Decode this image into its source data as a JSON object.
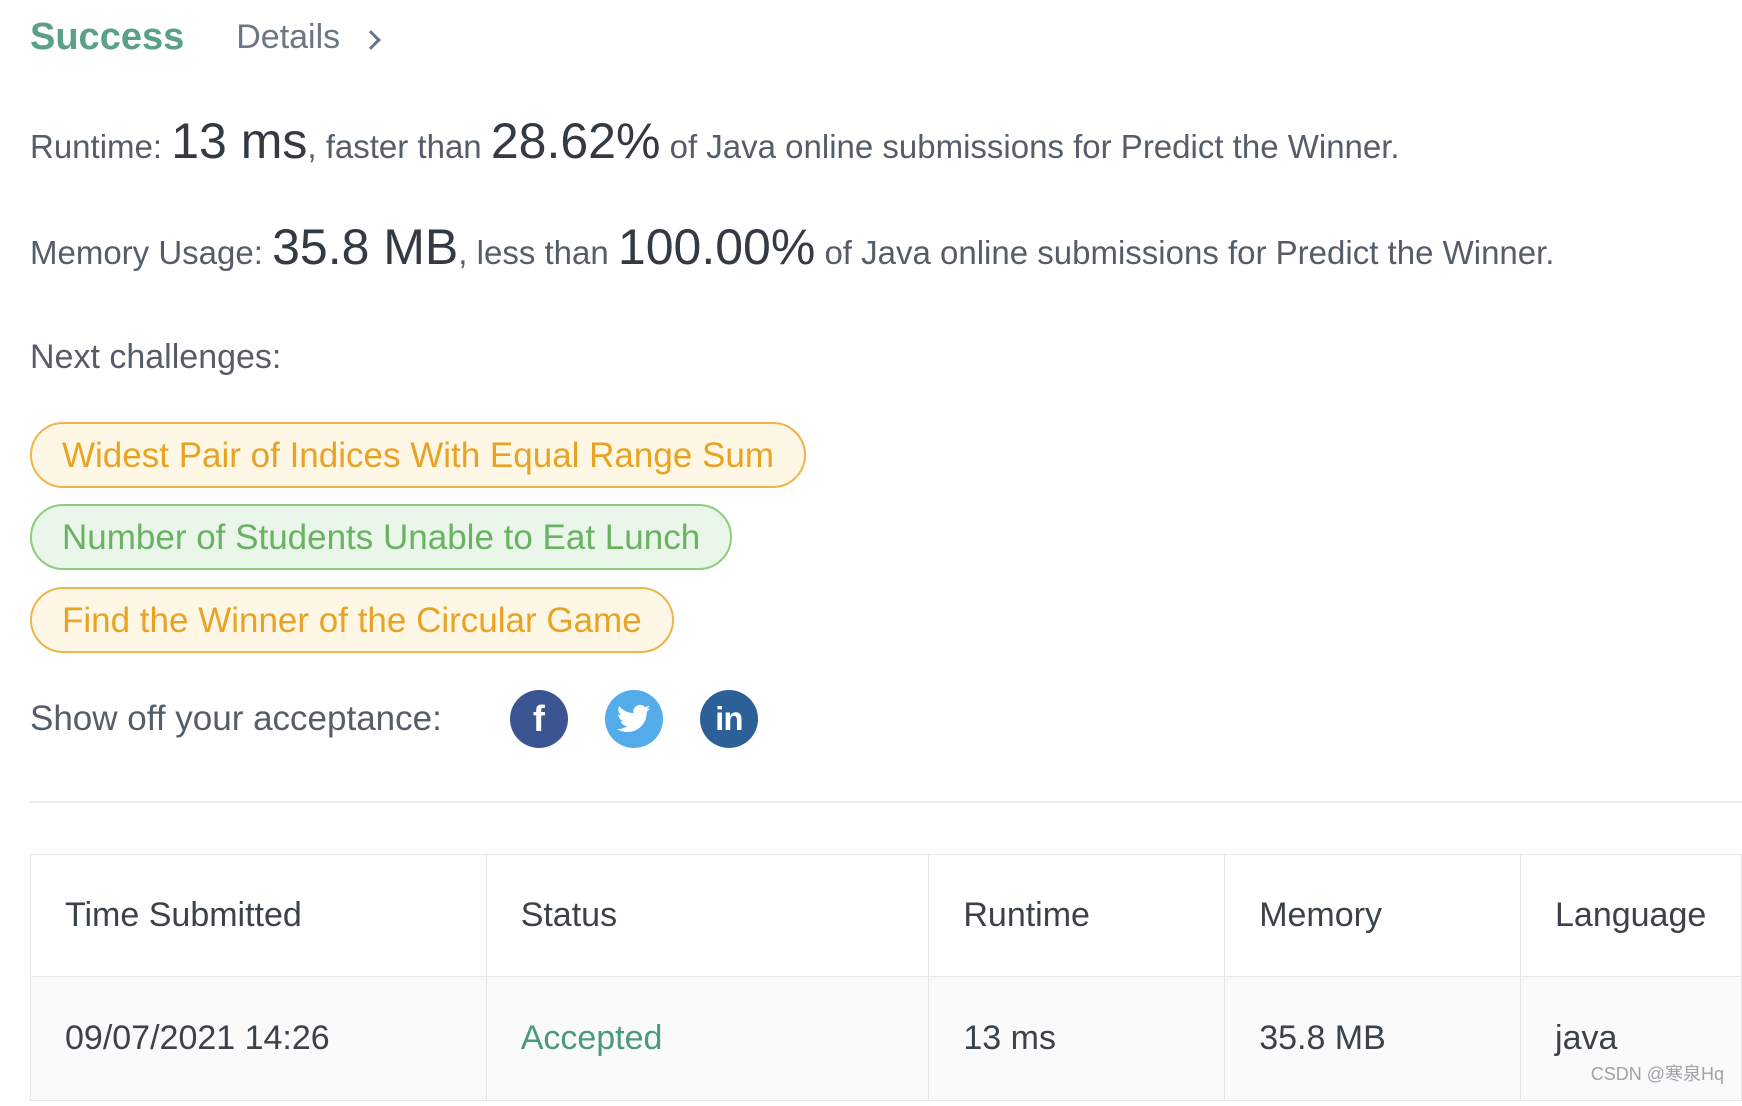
{
  "tabs": {
    "success": "Success",
    "details": "Details"
  },
  "runtime": {
    "label": "Runtime: ",
    "value": "13 ms",
    "mid": ", faster than ",
    "percent": "28.62%",
    "suffix": " of Java online submissions for Predict the Winner."
  },
  "memory": {
    "label": "Memory Usage: ",
    "value": "35.8 MB",
    "mid": ", less than ",
    "percent": "100.00%",
    "suffix": " of Java online submissions for Predict the Winner."
  },
  "next": {
    "label": "Next challenges:",
    "challenges": [
      {
        "title": "Widest Pair of Indices With Equal Range Sum",
        "difficulty": "medium"
      },
      {
        "title": "Number of Students Unable to Eat Lunch",
        "difficulty": "easy"
      },
      {
        "title": "Find the Winner of the Circular Game",
        "difficulty": "medium"
      }
    ]
  },
  "share": {
    "label": "Show off your acceptance:",
    "icons": [
      "facebook-icon",
      "twitter-icon",
      "linkedin-icon"
    ],
    "facebook_glyph": "f",
    "linkedin_glyph": "in"
  },
  "table": {
    "headers": [
      "Time Submitted",
      "Status",
      "Runtime",
      "Memory",
      "Language"
    ],
    "rows": [
      {
        "time": "09/07/2021 14:26",
        "status": "Accepted",
        "runtime": "13 ms",
        "memory": "35.8 MB",
        "language": "java"
      }
    ]
  },
  "watermark": "CSDN @寒泉Hq",
  "colors": {
    "success": "#5aa08a",
    "medium": "#e8a323",
    "easy": "#69b261",
    "facebook": "#3b5592",
    "twitter": "#55aceb",
    "linkedin": "#2c6096"
  }
}
